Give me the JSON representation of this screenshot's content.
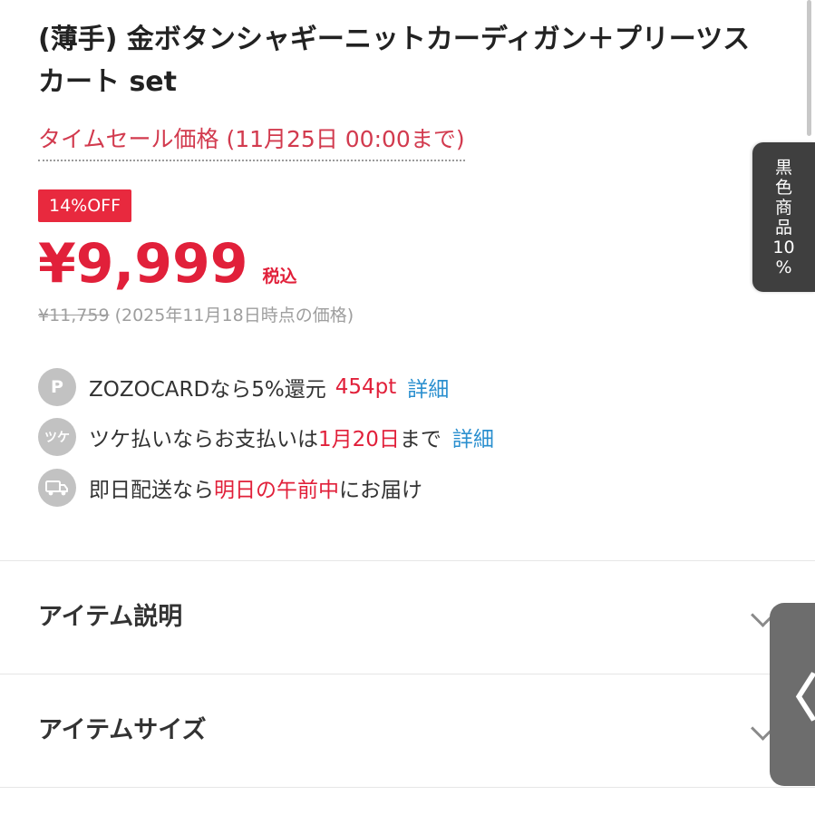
{
  "product": {
    "title": "(薄手) 金ボタンシャギーニットカーディガン＋プリーツスカート set"
  },
  "pricing": {
    "time_sale_label": "タイムセール価格 (11月25日 00:00まで)",
    "discount_badge": "14%OFF",
    "price": "¥9,999",
    "tax_label": "税込",
    "original_price": "¥11,759",
    "original_note": "(2025年11月18日時点の価格)"
  },
  "benefits": {
    "points": {
      "icon": "points-icon",
      "icon_text": "P",
      "text": "ZOZOCARDなら5%還元",
      "value": "454pt",
      "link": "詳細"
    },
    "tsuke": {
      "icon": "tsuke-pay-icon",
      "icon_text": "ツケ",
      "text_before": "ツケ払いならお支払いは",
      "date": "1月20日",
      "text_after": "まで",
      "link": "詳細"
    },
    "delivery": {
      "icon": "truck-icon",
      "text_before": "即日配送なら",
      "highlight": "明日の午前中",
      "text_after": "にお届け"
    }
  },
  "accordions": [
    {
      "label": "アイテム説明",
      "icon": "chevron-down-icon"
    },
    {
      "label": "アイテムサイズ",
      "icon": "chevron-down-icon"
    }
  ],
  "side_tab": {
    "chars": [
      "黒",
      "色",
      "商",
      "品",
      "10",
      "%"
    ]
  },
  "side_handle": {
    "glyph": "〈",
    "icon": "chevron-left-icon"
  },
  "colors": {
    "accent_red": "#e1203a",
    "link_blue": "#2a8fcf",
    "side_tab_bg": "#3f3f3f"
  }
}
